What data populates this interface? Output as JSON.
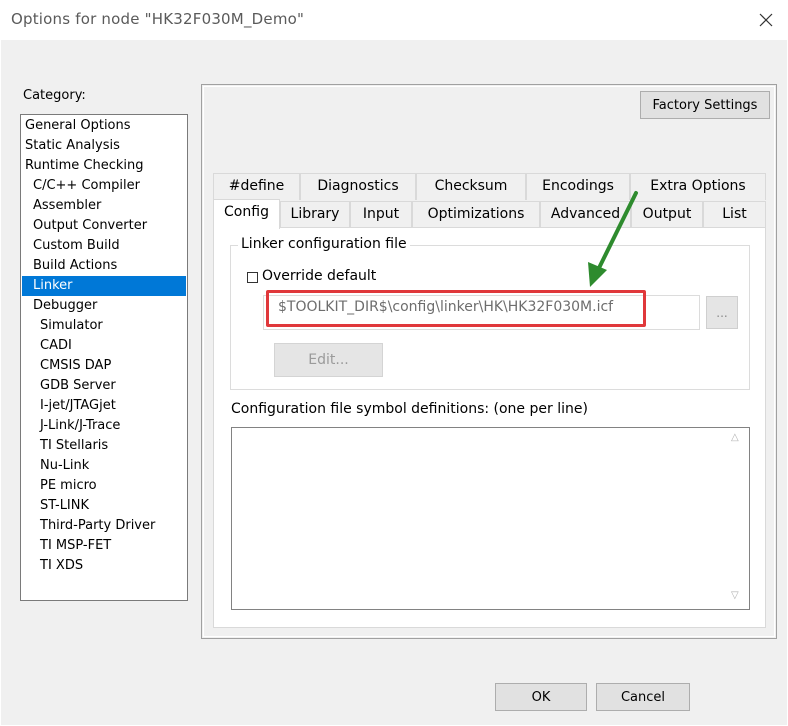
{
  "window": {
    "title": "Options for node \"HK32F030M_Demo\""
  },
  "category": {
    "label": "Category:",
    "items": [
      {
        "label": "General Options",
        "indent": 0
      },
      {
        "label": "Static Analysis",
        "indent": 0
      },
      {
        "label": "Runtime Checking",
        "indent": 0
      },
      {
        "label": "C/C++ Compiler",
        "indent": 1
      },
      {
        "label": "Assembler",
        "indent": 1
      },
      {
        "label": "Output Converter",
        "indent": 1
      },
      {
        "label": "Custom Build",
        "indent": 1
      },
      {
        "label": "Build Actions",
        "indent": 1
      },
      {
        "label": "Linker",
        "indent": 1,
        "selected": true
      },
      {
        "label": "Debugger",
        "indent": 1
      },
      {
        "label": "Simulator",
        "indent": 2
      },
      {
        "label": "CADI",
        "indent": 2
      },
      {
        "label": "CMSIS DAP",
        "indent": 2
      },
      {
        "label": "GDB Server",
        "indent": 2
      },
      {
        "label": "I-jet/JTAGjet",
        "indent": 2
      },
      {
        "label": "J-Link/J-Trace",
        "indent": 2
      },
      {
        "label": "TI Stellaris",
        "indent": 2
      },
      {
        "label": "Nu-Link",
        "indent": 2
      },
      {
        "label": "PE micro",
        "indent": 2
      },
      {
        "label": "ST-LINK",
        "indent": 2
      },
      {
        "label": "Third-Party Driver",
        "indent": 2
      },
      {
        "label": "TI MSP-FET",
        "indent": 2
      },
      {
        "label": "TI XDS",
        "indent": 2
      }
    ]
  },
  "panel": {
    "factory_settings": "Factory Settings",
    "tabs_row1": [
      "#define",
      "Diagnostics",
      "Checksum",
      "Encodings",
      "Extra Options"
    ],
    "tabs_row2": [
      "Config",
      "Library",
      "Input",
      "Optimizations",
      "Advanced",
      "Output",
      "List"
    ],
    "active_tab": "Config"
  },
  "config": {
    "group_title": "Linker configuration file",
    "override_label": "Override default",
    "override_checked": false,
    "path_value": "$TOOLKIT_DIR$\\config\\linker\\HK\\HK32F030M.icf",
    "browse_label": "...",
    "edit_label": "Edit...",
    "symbols_label": "Configuration file symbol definitions: (one per line)",
    "symbols_value": ""
  },
  "footer": {
    "ok_label": "OK",
    "cancel_label": "Cancel"
  },
  "colors": {
    "accent": "#0078d7",
    "highlight": "#e0383b",
    "arrow": "#2e8b2e"
  }
}
